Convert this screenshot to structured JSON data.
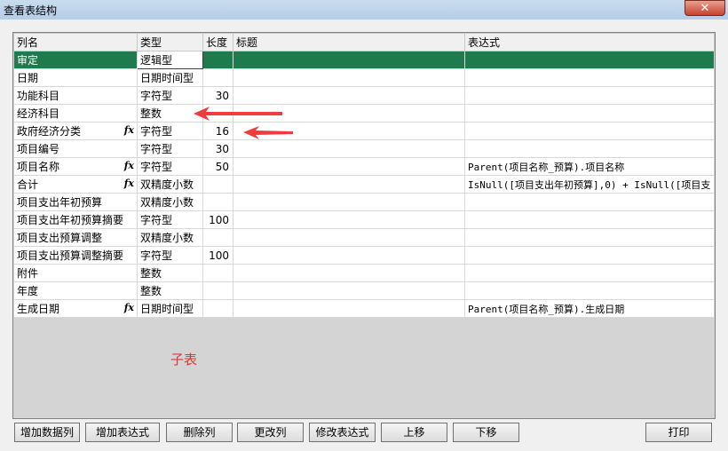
{
  "window": {
    "title": "查看表结构",
    "close_glyph": "✕"
  },
  "columns": [
    "列名",
    "类型",
    "长度",
    "标题",
    "表达式"
  ],
  "rows": [
    {
      "name": "审定",
      "type": "逻辑型",
      "length": "",
      "caption": "",
      "expr": "",
      "fx": false
    },
    {
      "name": "日期",
      "type": "日期时间型",
      "length": "",
      "caption": "",
      "expr": "",
      "fx": false
    },
    {
      "name": "功能科目",
      "type": "字符型",
      "length": "30",
      "caption": "",
      "expr": "",
      "fx": false
    },
    {
      "name": "经济科目",
      "type": "整数",
      "length": "",
      "caption": "",
      "expr": "",
      "fx": false
    },
    {
      "name": "政府经济分类",
      "type": "字符型",
      "length": "16",
      "caption": "",
      "expr": "",
      "fx": true
    },
    {
      "name": "项目编号",
      "type": "字符型",
      "length": "30",
      "caption": "",
      "expr": "",
      "fx": false
    },
    {
      "name": "项目名称",
      "type": "字符型",
      "length": "50",
      "caption": "",
      "expr": "Parent(项目名称_预算).项目名称",
      "fx": true
    },
    {
      "name": "合计",
      "type": "双精度小数",
      "length": "",
      "caption": "",
      "expr": "IsNull([项目支出年初预算],0)  + IsNull([项目支",
      "fx": true
    },
    {
      "name": "项目支出年初预算",
      "type": "双精度小数",
      "length": "",
      "caption": "",
      "expr": "",
      "fx": false
    },
    {
      "name": "项目支出年初预算摘要",
      "type": "字符型",
      "length": "100",
      "caption": "",
      "expr": "",
      "fx": false
    },
    {
      "name": "项目支出预算调整",
      "type": "双精度小数",
      "length": "",
      "caption": "",
      "expr": "",
      "fx": false
    },
    {
      "name": "项目支出预算调整摘要",
      "type": "字符型",
      "length": "100",
      "caption": "",
      "expr": "",
      "fx": false
    },
    {
      "name": "附件",
      "type": "整数",
      "length": "",
      "caption": "",
      "expr": "",
      "fx": false
    },
    {
      "name": "年度",
      "type": "整数",
      "length": "",
      "caption": "",
      "expr": "",
      "fx": false
    },
    {
      "name": "生成日期",
      "type": "日期时间型",
      "length": "",
      "caption": "",
      "expr": "Parent(项目名称_预算).生成日期",
      "fx": true
    }
  ],
  "selected_row": 0,
  "fx_label": "fx",
  "annotation": "子表",
  "annotation_color": "#e53333",
  "buttons": [
    "增加数据列",
    "增加表达式",
    "删除列",
    "更改列",
    "修改表达式",
    "上移",
    "下移",
    "打印"
  ]
}
